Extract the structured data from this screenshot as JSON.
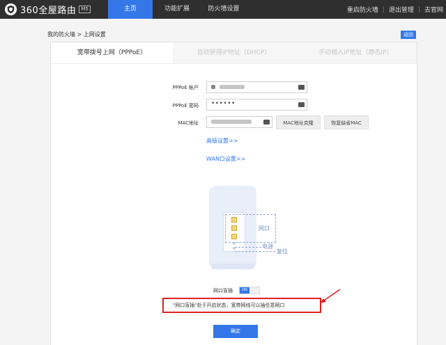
{
  "header": {
    "logo_text": "360全屋路由",
    "model_badge": "M5",
    "nav": [
      {
        "label": "主页",
        "active": true
      },
      {
        "label": "功能扩展",
        "active": false
      },
      {
        "label": "防火墙设置",
        "active": false
      }
    ],
    "actions": [
      "重启防火墙",
      "退出管理",
      "去官网"
    ]
  },
  "breadcrumb": {
    "parent": "我的防火墙",
    "separator": ">",
    "current": "上网设置"
  },
  "back_label": "返回",
  "tabs": [
    {
      "label": "宽带拨号上网（PPPoE）",
      "active": true
    },
    {
      "label": "自动获得IP地址（DHCP）",
      "active": false
    },
    {
      "label": "手动输入IP地址（静态IP）",
      "active": false
    }
  ],
  "form": {
    "account_label": "PPPoE 帐户",
    "password_label": "PPPoE 密码",
    "password_value": "••••••",
    "mac_label": "MAC地址",
    "mac_clone_label": "MAC地址克隆",
    "mac_restore_label": "恢复缺省MAC",
    "advanced_link": "高级设置>>",
    "wan_link": "WAN口设置>>"
  },
  "illustration": {
    "port_label": "网口",
    "power_label": "电源",
    "reset_label": "复位"
  },
  "blind_insert": {
    "label": "网口盲插",
    "toggle_state": "ON",
    "notice": "\"网口盲插\"处于开启状态，宽带网线可以插任意网口"
  },
  "confirm_label": "确定",
  "colors": {
    "accent": "#3377e8",
    "topbar": "#2f2f2f",
    "highlight": "#e02020"
  }
}
